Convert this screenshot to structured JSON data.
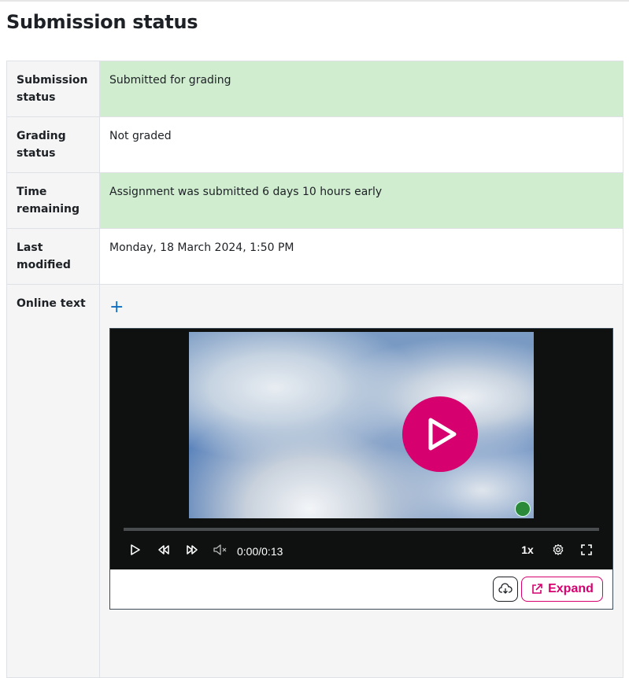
{
  "page_title": "Submission status",
  "rows": [
    {
      "label": "Submission status",
      "value": "Submitted for grading",
      "style": "green"
    },
    {
      "label": "Grading status",
      "value": "Not graded",
      "style": "white"
    },
    {
      "label": "Time remaining",
      "value": "Assignment was submitted 6 days 10 hours early",
      "style": "green"
    },
    {
      "label": "Last modified",
      "value": "Monday, 18 March 2024, 1:50 PM",
      "style": "white"
    },
    {
      "label": "Online text",
      "value": "",
      "style": "grey"
    }
  ],
  "online_text": {
    "expand_toggle": "+",
    "player": {
      "time": "0:00/0:13",
      "speed": "1x",
      "progress": 0,
      "expand_label": "Expand",
      "icons": [
        "play-icon",
        "rewind-icon",
        "fast-forward-icon",
        "mute-icon",
        "settings-icon",
        "fullscreen-icon",
        "download-icon",
        "external-link-icon"
      ]
    }
  },
  "colors": {
    "accent": "#d6006e",
    "success_bg": "#d0edd0",
    "link": "#0f6cbf"
  }
}
